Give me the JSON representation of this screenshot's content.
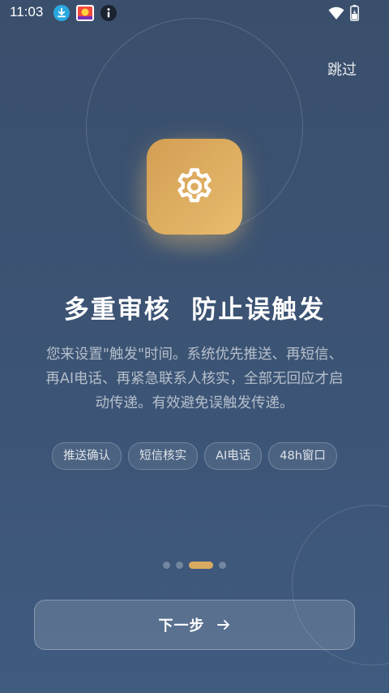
{
  "status_bar": {
    "time": "11:03",
    "icons": [
      "download-icon",
      "app-notification-icon",
      "info-icon",
      "wifi-icon",
      "battery-icon"
    ]
  },
  "header": {
    "skip_label": "跳过"
  },
  "feature": {
    "icon": "gear-icon",
    "accent_color": "#d9a961"
  },
  "content": {
    "headline": "多重审核  防止误触发",
    "description": "您来设置\"触发\"时间。系统优先推送、再短信、再AI电话、再紧急联系人核实，全部无回应才启动传递。有效避免误触发传递。",
    "chips": [
      {
        "label": "推送确认"
      },
      {
        "label": "短信核实"
      },
      {
        "label": "AI电话"
      },
      {
        "label": "48h窗口"
      }
    ]
  },
  "pager": {
    "total": 4,
    "current": 3
  },
  "footer": {
    "next_label": "下一步",
    "next_icon": "arrow-right-icon"
  }
}
